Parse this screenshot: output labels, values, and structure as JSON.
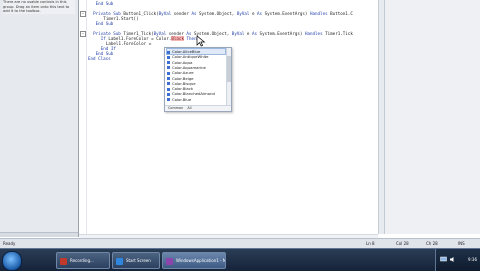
{
  "toolbox": {
    "hint_text": "There are no usable controls in this group. Drag an item onto this text to add it to the toolbox."
  },
  "editor": {
    "lines": [
      {
        "key": "l0",
        "indent": 3,
        "collapse": false,
        "segs": [
          {
            "t": "End Sub",
            "k": true
          }
        ]
      },
      {
        "key": "l1",
        "indent": 0,
        "collapse": false,
        "segs": [
          {
            "t": "",
            "k": false
          }
        ]
      },
      {
        "key": "l2",
        "indent": 2,
        "collapse": true,
        "segs": [
          {
            "t": "Private Sub ",
            "k": true
          },
          {
            "t": "Button1_Click(",
            "k": false
          },
          {
            "t": "ByVal",
            "k": true
          },
          {
            "t": " sender ",
            "k": false
          },
          {
            "t": "As",
            "k": true
          },
          {
            "t": " System.Object, ",
            "k": false
          },
          {
            "t": "ByVal",
            "k": true
          },
          {
            "t": " e ",
            "k": false
          },
          {
            "t": "As",
            "k": true
          },
          {
            "t": " System.EventArgs) ",
            "k": false
          },
          {
            "t": "Handles",
            "k": true
          },
          {
            "t": " Button1.C",
            "k": false
          }
        ]
      },
      {
        "key": "l3",
        "indent": 6,
        "collapse": false,
        "segs": [
          {
            "t": "Timer1.Start()",
            "k": false
          }
        ]
      },
      {
        "key": "l4",
        "indent": 3,
        "collapse": false,
        "segs": [
          {
            "t": "End Sub",
            "k": true
          }
        ]
      },
      {
        "key": "l5",
        "indent": 0,
        "collapse": false,
        "segs": [
          {
            "t": "",
            "k": false
          }
        ]
      },
      {
        "key": "l6",
        "indent": 2,
        "collapse": true,
        "segs": [
          {
            "t": "Private Sub ",
            "k": true
          },
          {
            "t": "Timer1_Tick(",
            "k": false
          },
          {
            "t": "ByVal",
            "k": true
          },
          {
            "t": " sender ",
            "k": false
          },
          {
            "t": "As",
            "k": true
          },
          {
            "t": " System.Object, ",
            "k": false
          },
          {
            "t": "ByVal",
            "k": true
          },
          {
            "t": " e ",
            "k": false
          },
          {
            "t": "As",
            "k": true
          },
          {
            "t": " System.EventArgs) ",
            "k": false
          },
          {
            "t": "Handles",
            "k": true
          },
          {
            "t": " Timer1.Tick",
            "k": false
          }
        ]
      },
      {
        "key": "l7",
        "indent": 5,
        "collapse": false,
        "segs": [
          {
            "t": "If",
            "k": true
          },
          {
            "t": " Label1.ForeColor = Color.",
            "k": false
          },
          {
            "t": "Black",
            "k": false,
            "h": true
          },
          {
            "t": " ",
            "k": false
          },
          {
            "t": "Then",
            "k": true
          }
        ]
      },
      {
        "key": "l8",
        "indent": 7,
        "collapse": false,
        "segs": [
          {
            "t": "Label1.ForeColor = ",
            "k": false
          }
        ]
      },
      {
        "key": "l9",
        "indent": 5,
        "collapse": false,
        "segs": [
          {
            "t": "End If",
            "k": true
          }
        ]
      },
      {
        "key": "l10",
        "indent": 3,
        "collapse": false,
        "segs": [
          {
            "t": "End Sub",
            "k": true
          }
        ]
      },
      {
        "key": "l11",
        "indent": 0,
        "collapse": false,
        "segs": [
          {
            "t": "End Class",
            "k": true
          }
        ]
      }
    ]
  },
  "intellisense": {
    "items": [
      "Color.AliceBlue",
      "Color.AntiqueWhite",
      "Color.Aqua",
      "Color.Aquamarine",
      "Color.Azure",
      "Color.Beige",
      "Color.Bisque",
      "Color.Black",
      "Color.BlanchedAlmond",
      "Color.Blue"
    ],
    "selected_index": 0,
    "tabs": [
      "Common",
      "All"
    ]
  },
  "status": {
    "left": "Ready",
    "ln": "Ln 8",
    "col": "Col 28",
    "ch": "Ch 28",
    "mode": "INS"
  },
  "taskbar": {
    "buttons": [
      {
        "label": "Recording...",
        "color": "#c0392b",
        "active": false
      },
      {
        "label": "Start Screen",
        "color": "#2e86de",
        "active": false
      },
      {
        "label": "WindowsApplication1 - Micros...",
        "color": "#8e44ad",
        "active": true
      }
    ],
    "clock": "9:36"
  },
  "colors": {
    "keyword": "#1f3da8",
    "highlight": "#f4b8b8"
  }
}
